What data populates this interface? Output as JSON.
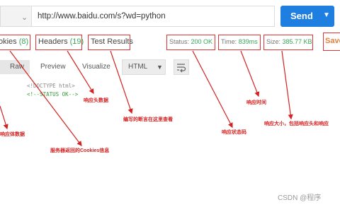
{
  "request": {
    "url": "http://www.baidu.com/s?wd=python",
    "send_label": "Send"
  },
  "tabs": {
    "cookies": {
      "label": "okies",
      "count": "(8)"
    },
    "headers": {
      "label": "Headers",
      "count": "(19)"
    },
    "tests": {
      "label": "Test Results"
    }
  },
  "status": {
    "status_label": "Status:",
    "status_value": "200 OK",
    "time_label": "Time:",
    "time_value": "839ms",
    "size_label": "Size:",
    "size_value": "385.77 KB",
    "save_label": "Save"
  },
  "body_toolbar": {
    "raw": "Raw",
    "preview": "Preview",
    "visualize": "Visualize",
    "format": "HTML"
  },
  "code_lines": [
    "<!DOCTYPE html>",
    "<!--STATUS OK-->"
  ],
  "annotations": {
    "response_headers": "响应头数据",
    "test_results": "编写的断言在这里查看",
    "response_time": "响应时间",
    "response_status": "响应状态码",
    "response_size": "响应大小，包括响应头和响应",
    "response_body": "响应体数据",
    "cookies_info": "服务器返回的Cookies信息"
  },
  "watermark": "CSDN @程序"
}
